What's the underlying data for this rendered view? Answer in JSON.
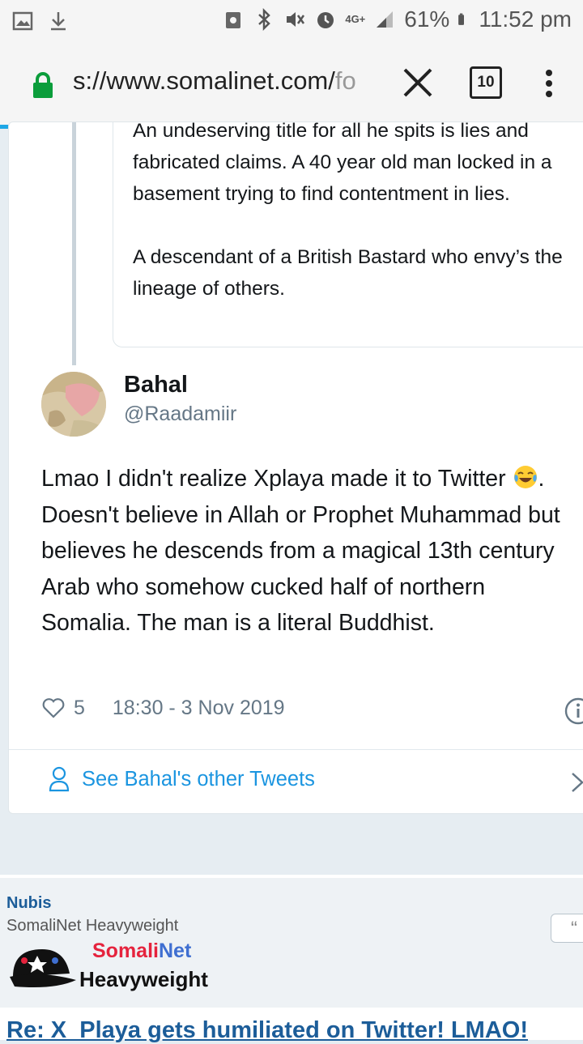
{
  "status_bar": {
    "battery": "61%",
    "time": "11:52 pm",
    "network": "4G+"
  },
  "browser": {
    "url": "s://www.somalinet.com/",
    "url_fade": "fo",
    "tab_count": "10"
  },
  "quoted_tweet": {
    "text": "An undeserving title for all he spits is lies and fabricated claims. A 40 year old man locked in a basement trying to find contentment in lies.\n\nA descendant of a British Bastard who envy’s the lineage of others."
  },
  "tweet": {
    "name": "Bahal",
    "handle": "@Raadamiir",
    "text_before_emoji": "Lmao I didn't realize Xplaya made it to Twitter ",
    "text_after_emoji": ". Doesn't believe in Allah or Prophet Muhammad but believes he descends from a magical 13th century Arab who somehow cucked half of northern Somalia. The man is a literal Buddhist.",
    "likes": "5",
    "timestamp": "18:30 - 3 Nov 2019",
    "see_other": "See Bahal's other Tweets"
  },
  "post": {
    "poster": "Nubis",
    "rank": "SomaliNet Heavyweight",
    "badge_red": "Somali",
    "badge_blue": "Net",
    "badge_rank": "Heavyweight",
    "quote_glyph": "“",
    "title": "Re: X_Playa gets humiliated on Twitter! LMAO!"
  },
  "colors": {
    "link_blue": "#1b95e0",
    "progress": "#1ea7e6",
    "forum_blue": "#1c5d99"
  }
}
